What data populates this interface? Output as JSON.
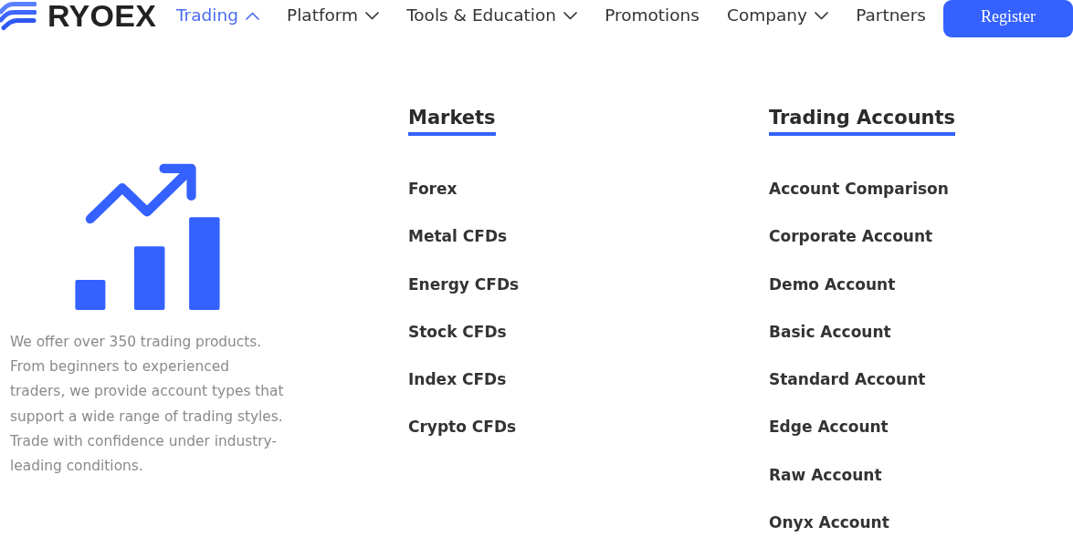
{
  "logo": {
    "text": "RYOEX"
  },
  "nav": {
    "items": [
      {
        "label": "Trading",
        "kind": "dropdown",
        "selected": true
      },
      {
        "label": "Platform",
        "kind": "dropdown",
        "selected": false
      },
      {
        "label": "Tools & Education",
        "kind": "dropdown",
        "selected": false
      },
      {
        "label": "Promotions",
        "kind": "link",
        "selected": false
      },
      {
        "label": "Company",
        "kind": "dropdown",
        "selected": false
      },
      {
        "label": "Partners",
        "kind": "link",
        "selected": false
      }
    ],
    "register_button": "Register"
  },
  "menu": {
    "intro": "We offer over 350 trading products. From beginners to experienced traders, we provide account types that support a wide range of trading styles. Trade with confidence under industry-leading conditions.",
    "sections": [
      {
        "title": "Markets",
        "items": [
          "Forex",
          "Metal CFDs",
          "Energy CFDs",
          "Stock CFDs",
          "Index CFDs",
          "Crypto CFDs"
        ]
      },
      {
        "title": "Trading Accounts",
        "items": [
          "Account Comparison",
          "Corporate Account",
          "Demo Account",
          "Basic Account",
          "Standard Account",
          "Edge Account",
          "Raw Account",
          "Onyx Account"
        ]
      }
    ]
  }
}
